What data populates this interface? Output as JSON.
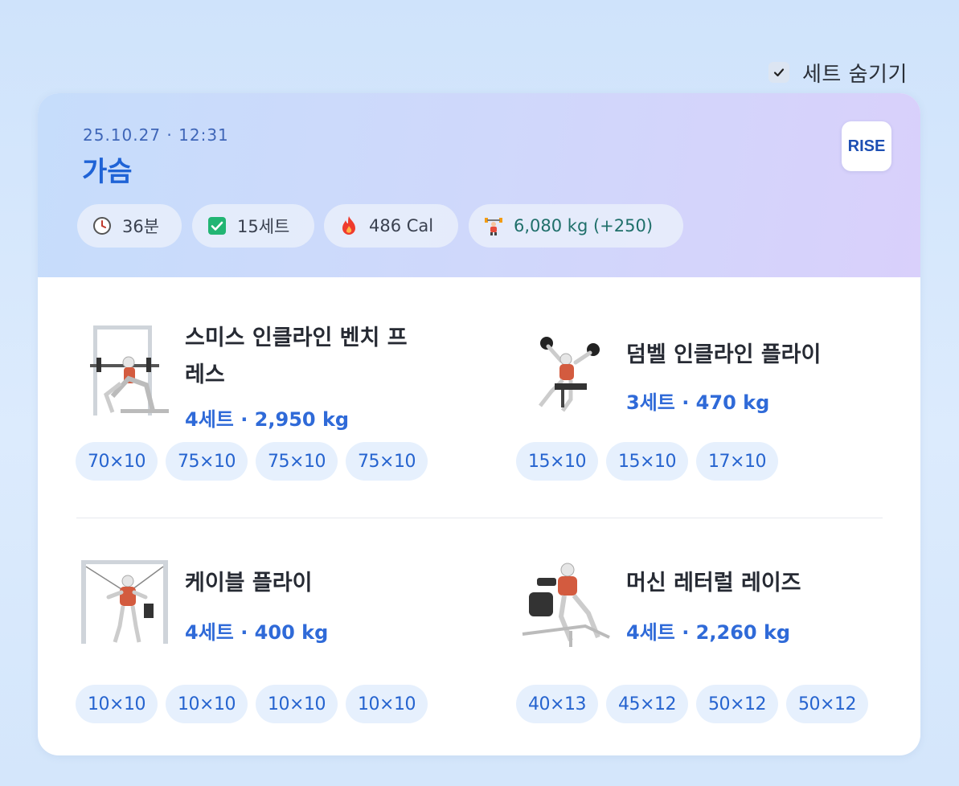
{
  "toggle": {
    "label": "세트 숨기기",
    "checked": true
  },
  "workout": {
    "date": "25.10.27 · 12:31",
    "title": "가슴",
    "brand": "RISE",
    "stats": {
      "duration": "36분",
      "sets": "15세트",
      "calories": "486 Cal",
      "volume": "6,080 kg (+250)"
    }
  },
  "exercises": [
    {
      "name": "스미스 인클라인 벤치 프레스",
      "meta": "4세트 · 2,950 kg",
      "sets": [
        "70×10",
        "75×10",
        "75×10",
        "75×10"
      ]
    },
    {
      "name": "덤벨 인클라인 플라이",
      "meta": "3세트 · 470 kg",
      "sets": [
        "15×10",
        "15×10",
        "17×10"
      ]
    },
    {
      "name": "케이블 플라이",
      "meta": "4세트 · 400 kg",
      "sets": [
        "10×10",
        "10×10",
        "10×10",
        "10×10"
      ]
    },
    {
      "name": "머신 레터럴 레이즈",
      "meta": "4세트 · 2,260 kg",
      "sets": [
        "40×13",
        "45×12",
        "50×12",
        "50×12"
      ]
    }
  ],
  "colors": {
    "accent": "#1f63d6",
    "chip_bg": "#e6f0fd",
    "teal": "#1f6f6a"
  },
  "icons": [
    "check-icon",
    "clock-icon",
    "checkbox-icon",
    "fire-icon",
    "weight-icon"
  ]
}
